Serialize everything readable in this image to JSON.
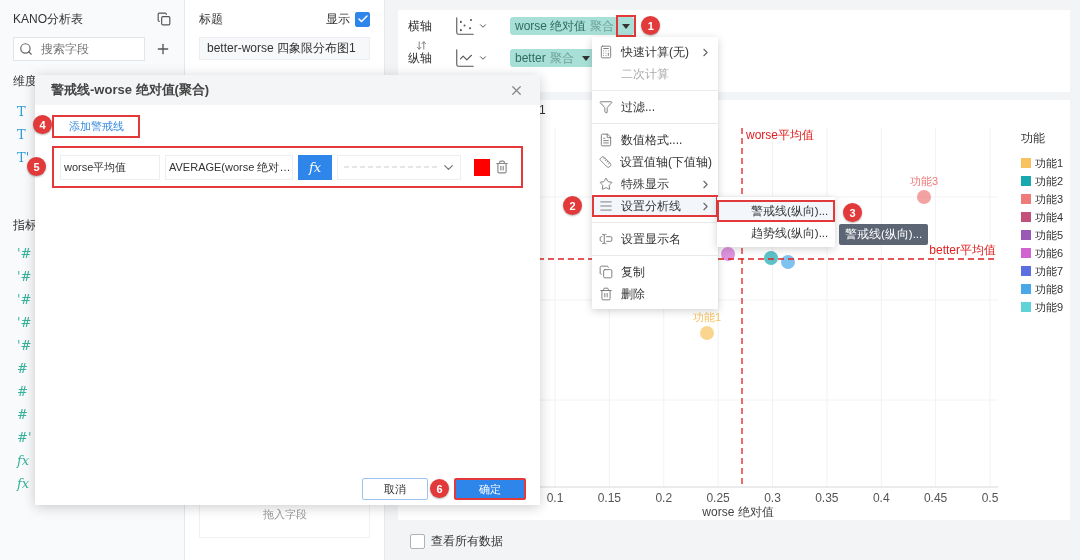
{
  "sidebar": {
    "title": "KANO分析表",
    "search": {
      "placeholder": "搜索字段"
    },
    "dimension_heading": "维度",
    "dimension_fields": [
      {
        "kind": "text",
        "icon": "T"
      },
      {
        "kind": "text",
        "icon": "T"
      },
      {
        "kind": "text",
        "icon": "T'"
      }
    ],
    "measure_heading": "指标",
    "measure_fields": [
      {
        "kind": "number",
        "icon": "'#"
      },
      {
        "kind": "number",
        "icon": "'#"
      },
      {
        "kind": "number",
        "icon": "'#"
      },
      {
        "kind": "number",
        "icon": "'#"
      },
      {
        "kind": "number",
        "icon": "'#"
      },
      {
        "kind": "number",
        "icon": "#"
      },
      {
        "kind": "number",
        "icon": "#"
      },
      {
        "kind": "number",
        "icon": "#"
      },
      {
        "kind": "number",
        "icon": "#'"
      },
      {
        "kind": "calc",
        "icon": "fx"
      },
      {
        "kind": "calc",
        "icon": "fx"
      }
    ]
  },
  "config": {
    "title_label": "标题",
    "show_label": "显示",
    "show_checked": true,
    "title_value": "better-worse 四象限分布图1",
    "drop_hint": "拖入字段"
  },
  "axes": [
    {
      "label": "横轴",
      "pill": "worse 绝对值",
      "pill_suffix": "聚合",
      "dropdown_highlighted": true,
      "marker": "1"
    },
    {
      "label": "纵轴",
      "pill": "better",
      "pill_suffix": "聚合",
      "dropdown_highlighted": false
    }
  ],
  "chart": {
    "title": "1",
    "x_ticks": [
      "0.1",
      "0.15",
      "0.2",
      "0.25",
      "0.3",
      "0.35",
      "0.4",
      "0.45",
      "0.5"
    ],
    "x_title": "worse 绝对值",
    "reference_labels": [
      "worse平均值",
      "better平均值"
    ],
    "point_labels": [
      "功能3",
      "功能1"
    ],
    "legend": {
      "title": "功能",
      "items": [
        {
          "name": "功能1",
          "color": "#f8c35f"
        },
        {
          "name": "功能2",
          "color": "#17a8b0"
        },
        {
          "name": "功能3",
          "color": "#ee7a7a"
        },
        {
          "name": "功能4",
          "color": "#c2507a"
        },
        {
          "name": "功能5",
          "color": "#9b59b6"
        },
        {
          "name": "功能6",
          "color": "#d065d2"
        },
        {
          "name": "功能7",
          "color": "#5b6fe0"
        },
        {
          "name": "功能8",
          "color": "#4aa8e8"
        },
        {
          "name": "功能9",
          "color": "#5fd3d8"
        }
      ]
    }
  },
  "show_all": {
    "label": "查看所有数据",
    "checked": false
  },
  "dialog": {
    "title": "警戒线-worse 绝对值(聚合)",
    "add_button": "添加警戒线",
    "add_marker": "4",
    "row_marker": "5",
    "lines": [
      {
        "name": "worse平均值",
        "formula": "AVERAGE(worse 绝对…",
        "fx": "fx",
        "color": "#ff0000"
      }
    ],
    "cancel": "取消",
    "ok": "确定",
    "ok_marker": "6"
  },
  "context_menu": {
    "items": [
      {
        "kind": "item",
        "label": "快速计算(无)",
        "submenu": true,
        "disabled": false,
        "highlighted": false
      },
      {
        "kind": "item",
        "label": "二次计算",
        "submenu": false,
        "disabled": true,
        "highlighted": false
      },
      {
        "kind": "divider"
      },
      {
        "kind": "item",
        "label": "过滤...",
        "submenu": false,
        "disabled": false,
        "highlighted": false
      },
      {
        "kind": "divider"
      },
      {
        "kind": "item",
        "label": "数值格式....",
        "submenu": false,
        "disabled": false,
        "highlighted": false
      },
      {
        "kind": "item",
        "label": "设置值轴(下值轴)",
        "submenu": false,
        "disabled": false,
        "highlighted": false
      },
      {
        "kind": "item",
        "label": "特殊显示",
        "submenu": true,
        "disabled": false,
        "highlighted": false
      },
      {
        "kind": "item",
        "label": "设置分析线",
        "submenu": true,
        "disabled": false,
        "highlighted": true,
        "marker": "2"
      },
      {
        "kind": "divider"
      },
      {
        "kind": "item",
        "label": "设置显示名",
        "submenu": false,
        "disabled": false,
        "highlighted": false
      },
      {
        "kind": "divider"
      },
      {
        "kind": "item",
        "label": "复制",
        "submenu": false,
        "disabled": false,
        "highlighted": false
      },
      {
        "kind": "item",
        "label": "删除",
        "submenu": false,
        "disabled": false,
        "highlighted": false
      }
    ]
  },
  "submenu": {
    "items": [
      {
        "label": "警戒线(纵向)...",
        "highlighted": true,
        "marker": "3"
      },
      {
        "label": "趋势线(纵向)...",
        "highlighted": false
      }
    ]
  },
  "tooltip": "警戒线(纵向)..."
}
